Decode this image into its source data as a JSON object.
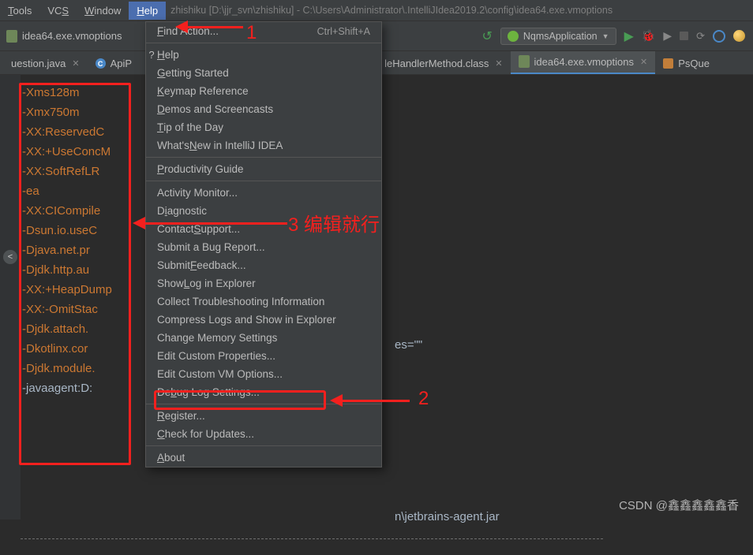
{
  "menubar": {
    "items": [
      "Tools",
      "VCS",
      "Window",
      "Help"
    ],
    "mnemonics": [
      "T",
      "S",
      "W",
      "H"
    ],
    "active": "Help",
    "title_path": "zhishiku [D:\\jjr_svn\\zhishiku] - C:\\Users\\Administrator\\.IntelliJIdea2019.2\\config\\idea64.exe.vmoptions"
  },
  "toolbar": {
    "breadcrumb_file": "idea64.exe.vmoptions",
    "run_config": "NqmsApplication"
  },
  "tabs": {
    "left_a": "uestion.java",
    "left_b": "ApiP",
    "mid": "leHandlerMethod.class",
    "active": "idea64.exe.vmoptions",
    "right": "PsQue"
  },
  "help_menu": {
    "find_action": "Find Action...",
    "find_action_shortcut": "Ctrl+Shift+A",
    "help": "Help",
    "getting_started": "Getting Started",
    "keymap": "Keymap Reference",
    "demos": "Demos and Screencasts",
    "tip": "Tip of the Day",
    "whatsnew": "What's New in IntelliJ IDEA",
    "productivity": "Productivity Guide",
    "activity": "Activity Monitor...",
    "diagnostic": "Diagnostic",
    "contact": "Contact Support...",
    "bug": "Submit a Bug Report...",
    "feedback": "Submit Feedback...",
    "showlog": "Show Log in Explorer",
    "troubleshoot": "Collect Troubleshooting Information",
    "compresslogs": "Compress Logs and Show in Explorer",
    "memory": "Change Memory Settings",
    "editprops": "Edit Custom Properties...",
    "editvm": "Edit Custom VM Options...",
    "debuglog": "Debug Log Settings...",
    "register": "Register...",
    "check": "Check for Updates...",
    "about": "About"
  },
  "code": {
    "l0": "-Xms128m",
    "l1": "-Xmx750m",
    "l2": "-XX:ReservedC",
    "l3": "-XX:+UseConcM",
    "l4": "-XX:SoftRefLR",
    "l5": "-ea",
    "l6": "-XX:CICompile",
    "l7": "-Dsun.io.useC",
    "l8": "-Djava.net.pr",
    "l9": "-Djdk.http.au",
    "l10": "-XX:+HeapDump",
    "l11": "-XX:-OmitStac",
    "l12": "-Djdk.attach.",
    "l13": "-Dkotlinx.cor",
    "l14": "-Djdk.module.",
    "l15": "-javaagent:D:",
    "right1": "es=\"\"",
    "right2": "n\\jetbrains-agent.jar"
  },
  "annotations": {
    "a1": "1",
    "a2": "2",
    "a3": "3 编辑就行"
  },
  "watermark": "CSDN @鑫鑫鑫鑫鑫香"
}
